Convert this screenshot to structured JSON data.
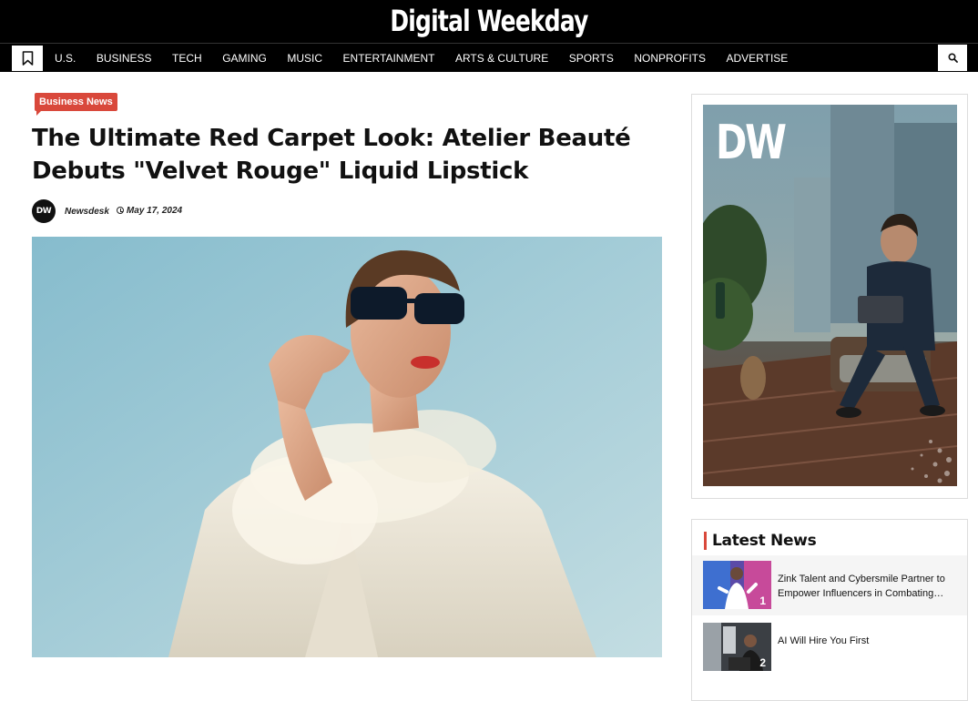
{
  "site": {
    "title": "Digital Weekday"
  },
  "nav": {
    "items": [
      "U.S.",
      "BUSINESS",
      "TECH",
      "GAMING",
      "MUSIC",
      "ENTERTAINMENT",
      "ARTS & CULTURE",
      "SPORTS",
      "NONPROFITS",
      "ADVERTISE"
    ],
    "bookmark_icon": "bookmark-icon",
    "search_icon": "search-icon"
  },
  "article": {
    "category": "Business News",
    "headline": "The Ultimate Red Carpet Look: Atelier Beauté Debuts \"Velvet Rouge\" Liquid Lipstick",
    "author": {
      "avatar_text": "DW",
      "name": "Newsdesk"
    },
    "date": "May 17, 2024",
    "hero_image": "woman-in-sunglasses-white-blazer-photo"
  },
  "sidebar": {
    "ad": {
      "logo_text": "DW",
      "image": "man-with-laptop-on-balcony-photo"
    },
    "latest": {
      "title": "Latest News",
      "items": [
        {
          "rank": "1",
          "title": "Zink Talent and Cybersmile Partner to Empower Influencers in Combating Online Hate"
        },
        {
          "rank": "2",
          "title": "AI Will Hire You First"
        }
      ]
    }
  },
  "colors": {
    "accent": "#d9483b",
    "header_bg": "#000000"
  }
}
